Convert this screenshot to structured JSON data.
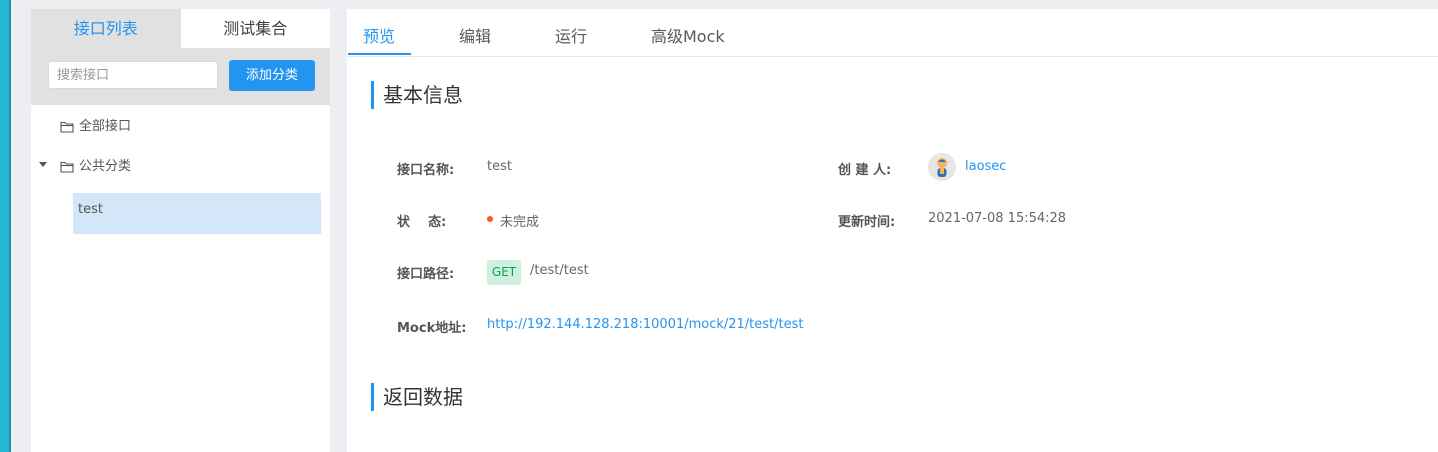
{
  "sidebar": {
    "tabs": [
      {
        "label": "接口列表",
        "active": true
      },
      {
        "label": "测试集合",
        "active": false
      }
    ],
    "search": {
      "placeholder": "搜索接口",
      "value": ""
    },
    "add_category_label": "添加分类",
    "tree": {
      "all_label": "全部接口",
      "category_label": "公共分类",
      "apis": [
        {
          "label": "test",
          "selected": true
        }
      ]
    }
  },
  "main": {
    "tabs": [
      {
        "label": "预览",
        "active": true
      },
      {
        "label": "编辑",
        "active": false
      },
      {
        "label": "运行",
        "active": false
      },
      {
        "label": "高级Mock",
        "active": false
      }
    ],
    "basic_info": {
      "title": "基本信息",
      "name_label": "接口名称:",
      "name_value": "test",
      "creator_label": "创 建 人:",
      "creator_value": "laosec",
      "status_label": "状 态:",
      "status_value": "未完成",
      "updated_label": "更新时间:",
      "updated_value": "2021-07-08 15:54:28",
      "path_label": "接口路径:",
      "method": "GET",
      "path_value": "/test/test",
      "mock_label": "Mock地址:",
      "mock_value": "http://192.144.128.218:10001/mock/21/test/test"
    },
    "response_title": "返回数据"
  },
  "colors": {
    "accent": "#2395f1",
    "status_dot": "#ff561b",
    "get_tag_bg": "#cfefdf",
    "get_tag_text": "#00a854",
    "edge_strip": "#29b6d3"
  },
  "icons": [
    "folder-icon",
    "caret-down-icon",
    "avatar-icon"
  ]
}
